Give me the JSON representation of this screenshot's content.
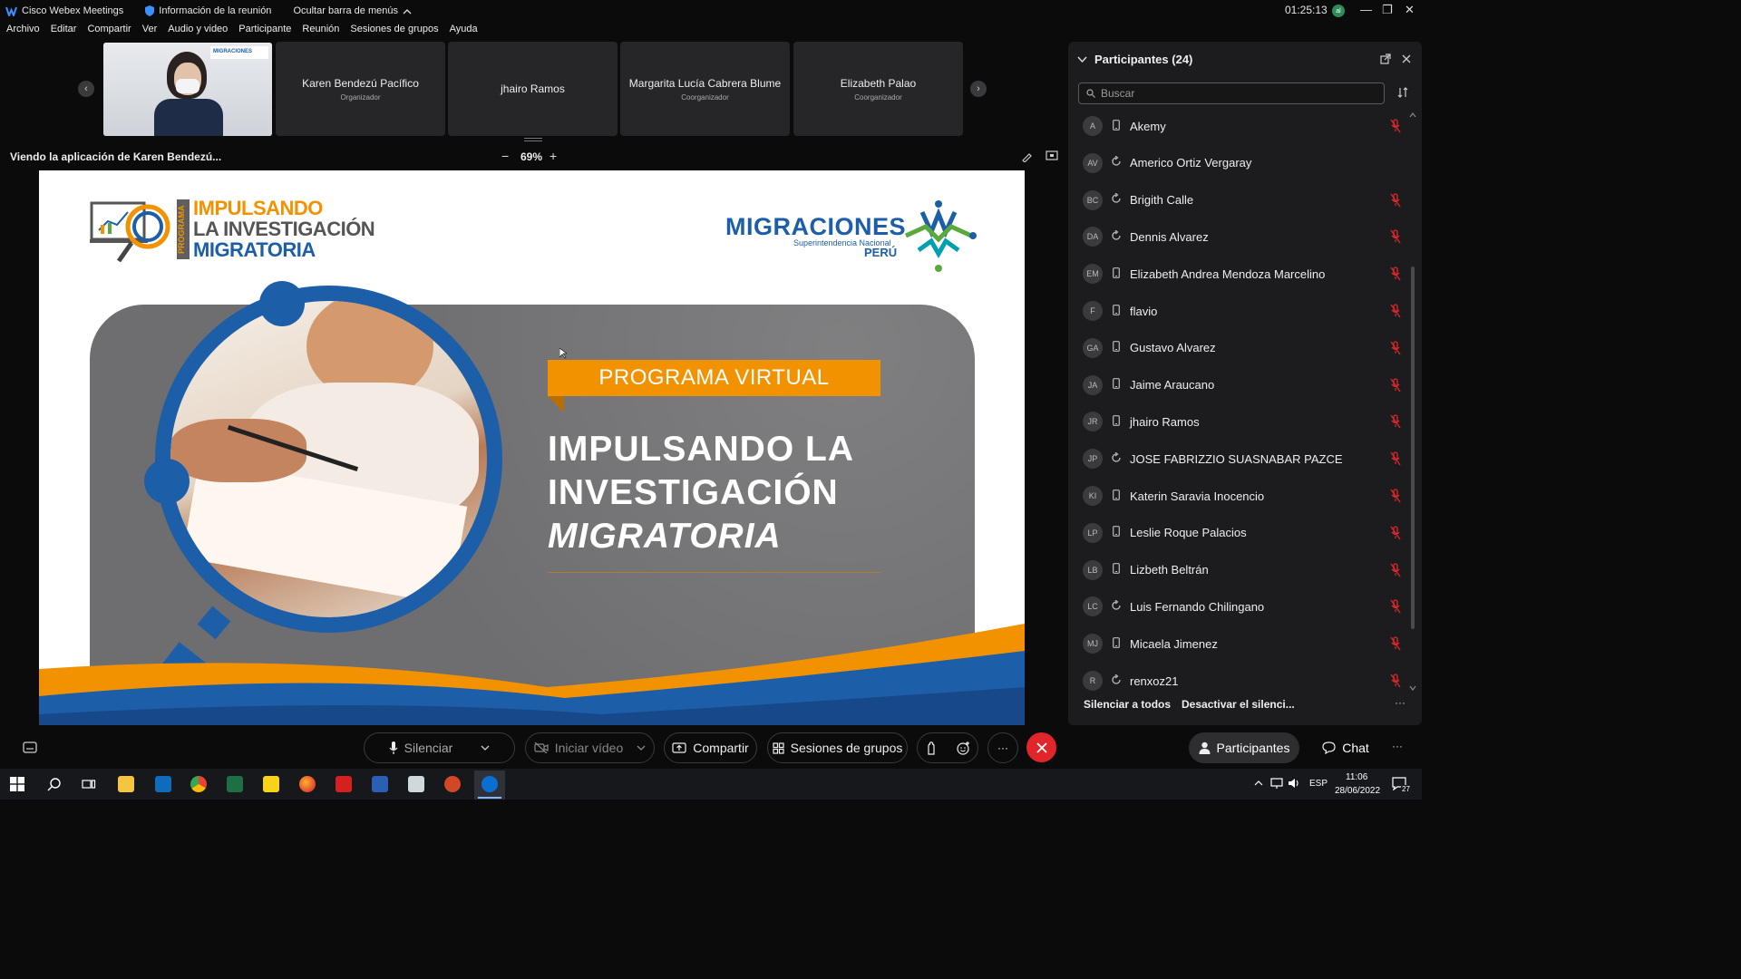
{
  "titlebar": {
    "app": "Cisco Webex Meetings",
    "meeting_info": "Información de la reunión",
    "hide_menu": "Ocultar barra de menús",
    "clock": "01:25:13",
    "user_initial": "al"
  },
  "menu": [
    "Archivo",
    "Editar",
    "Compartir",
    "Ver",
    "Audio y video",
    "Participante",
    "Reunión",
    "Sesiones de grupos",
    "Ayuda"
  ],
  "video_strip": [
    {
      "name": "Karen Bendezú Pacífico",
      "role": "Organizador"
    },
    {
      "name": "jhairo Ramos",
      "role": ""
    },
    {
      "name": "Margarita Lucía Cabrera Blume",
      "role": "Coorganizador"
    },
    {
      "name": "Elizabeth Palao",
      "role": "Coorganizador"
    }
  ],
  "video_thumb_logo": "MIGRACIONES",
  "viewing": {
    "text": "Viendo la aplicación de Karen Bendezú...",
    "zoom": "69%",
    "zoom_out": "−",
    "zoom_in": "+"
  },
  "slide": {
    "program_vertical": "PROGRAMA",
    "logo_line1": "IMPULSANDO",
    "logo_line2": "LA INVESTIGACIÓN",
    "logo_line3": "MIGRATORIA",
    "brand": "MIGRACIONES",
    "brand_sub": "Superintendencia Nacional",
    "brand_country": "PERÚ",
    "banner": "PROGRAMA VIRTUAL",
    "headline1": "IMPULSANDO LA",
    "headline2": "INVESTIGACIÓN",
    "headline3": "MIGRATORIA",
    "colors": {
      "orange": "#f39200",
      "blue": "#1d5ea8",
      "grey": "#6e6e70",
      "green": "#5ba83d"
    }
  },
  "participants": {
    "title": "Participantes (24)",
    "search_placeholder": "Buscar",
    "list": [
      {
        "initials": "A",
        "device": "phone",
        "name": "Akemy"
      },
      {
        "initials": "AV",
        "device": "sync",
        "name": "Americo Ortiz Vergaray"
      },
      {
        "initials": "BC",
        "device": "sync",
        "name": "Brigith Calle"
      },
      {
        "initials": "DA",
        "device": "sync",
        "name": "Dennis Alvarez"
      },
      {
        "initials": "EM",
        "device": "phone",
        "name": "Elizabeth Andrea Mendoza Marcelino"
      },
      {
        "initials": "F",
        "device": "phone",
        "name": "flavio"
      },
      {
        "initials": "GA",
        "device": "phone",
        "name": "Gustavo Alvarez"
      },
      {
        "initials": "JA",
        "device": "phone",
        "name": "Jaime Araucano"
      },
      {
        "initials": "JR",
        "device": "phone",
        "name": "jhairo Ramos"
      },
      {
        "initials": "JP",
        "device": "sync",
        "name": "JOSE FABRIZZIO SUASNABAR PAZCE"
      },
      {
        "initials": "KI",
        "device": "phone",
        "name": "Katerin Saravia Inocencio"
      },
      {
        "initials": "LP",
        "device": "phone",
        "name": "Leslie Roque Palacios"
      },
      {
        "initials": "LB",
        "device": "phone",
        "name": "Lizbeth Beltrán"
      },
      {
        "initials": "LC",
        "device": "sync",
        "name": "Luis Fernando Chilingano"
      },
      {
        "initials": "MJ",
        "device": "phone",
        "name": "Micaela Jimenez"
      },
      {
        "initials": "R",
        "device": "sync",
        "name": "renxoz21"
      }
    ],
    "mute_all": "Silenciar a todos",
    "unmute": "Desactivar el silenci...",
    "more": "···"
  },
  "controls": {
    "mute": "Silenciar",
    "video": "Iniciar vídeo",
    "share": "Compartir",
    "breakout": "Sesiones de grupos",
    "more": "···",
    "participants": "Participantes",
    "chat": "Chat",
    "end_color": "#e0262b"
  },
  "taskbar": {
    "lang": "ESP",
    "time": "11:06",
    "date": "28/06/2022",
    "notif": "27"
  }
}
